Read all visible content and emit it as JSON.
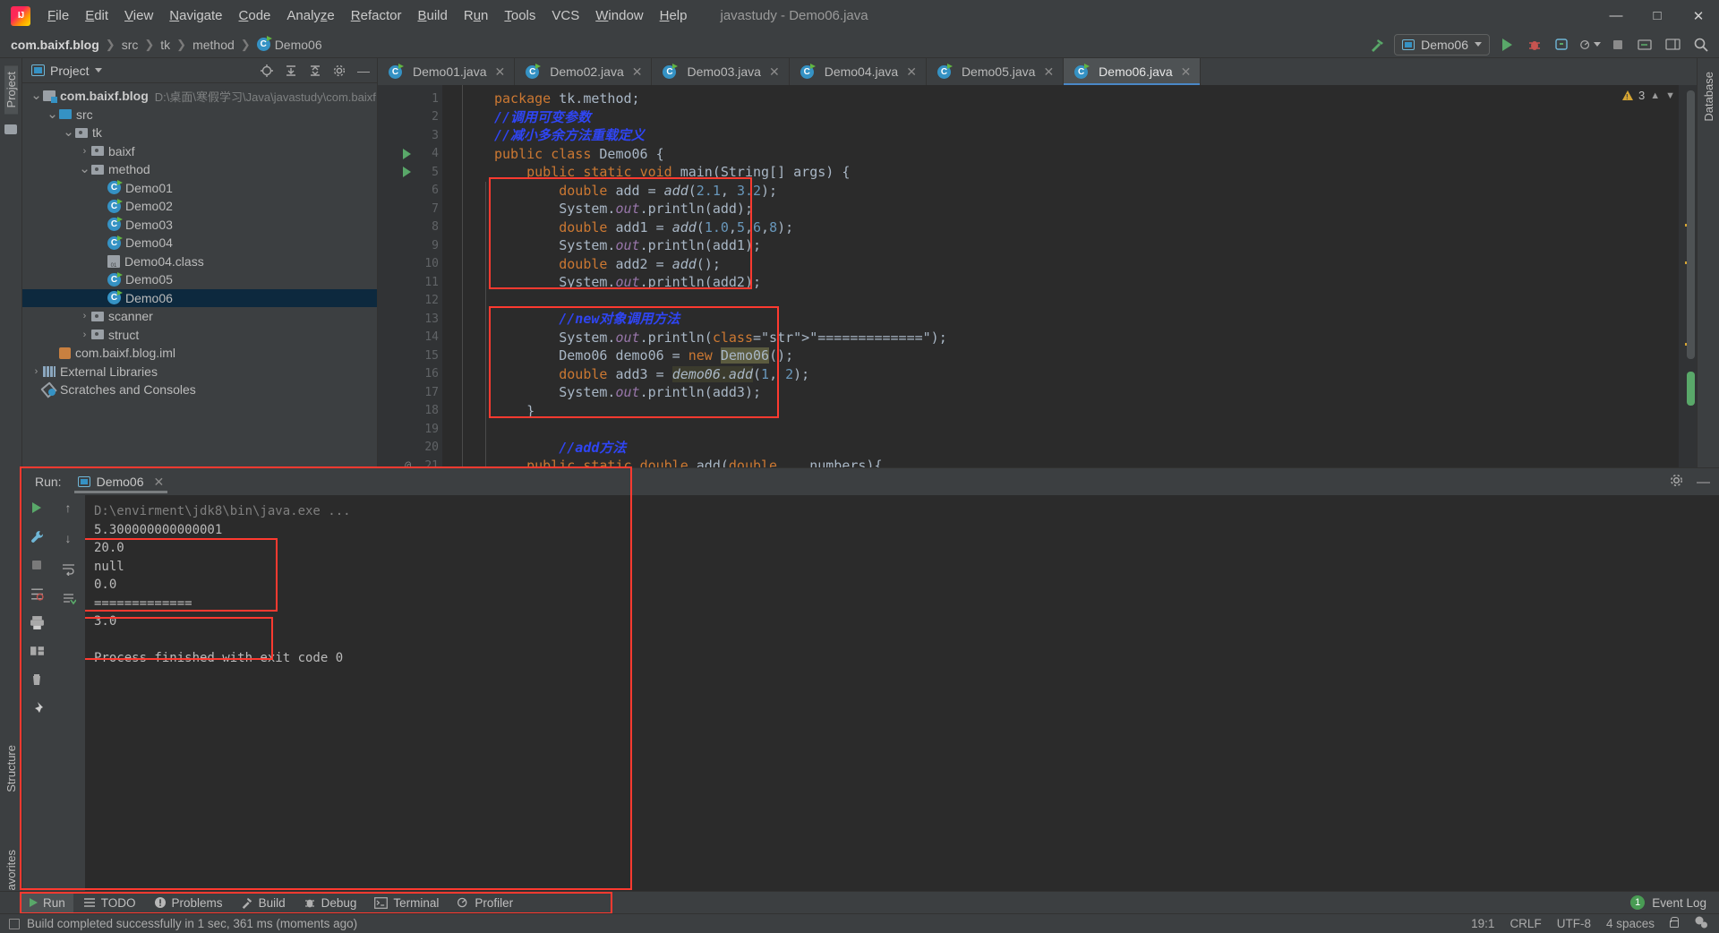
{
  "window": {
    "title": "javastudy - Demo06.java",
    "controls": [
      "minimize",
      "maximize",
      "close"
    ]
  },
  "menu": [
    {
      "label": "File"
    },
    {
      "label": "Edit"
    },
    {
      "label": "View"
    },
    {
      "label": "Navigate"
    },
    {
      "label": "Code"
    },
    {
      "label": "Analyze"
    },
    {
      "label": "Refactor"
    },
    {
      "label": "Build"
    },
    {
      "label": "Run"
    },
    {
      "label": "Tools"
    },
    {
      "label": "VCS"
    },
    {
      "label": "Window"
    },
    {
      "label": "Help"
    }
  ],
  "breadcrumb": {
    "items": [
      "com.baixf.blog",
      "src",
      "tk",
      "method",
      "Demo06"
    ]
  },
  "toolbar": {
    "run_config": "Demo06",
    "icons": [
      "hammer-icon",
      "run-icon",
      "debug-icon",
      "coverage-icon",
      "profile-icon",
      "stop-icon",
      "git-update-icon",
      "layout-icon",
      "search-icon"
    ]
  },
  "project_panel": {
    "title": "Project",
    "tools": [
      "locate-icon",
      "expand-all-icon",
      "collapse-all-icon",
      "settings-icon",
      "hide-icon"
    ],
    "tree": [
      {
        "label": "com.baixf.blog",
        "path": "D:\\桌面\\寒假学习\\Java\\javastudy\\com.baixf.b",
        "indent": 0,
        "arrow": "v",
        "icon": "module-icon",
        "bold": true,
        "selected": false
      },
      {
        "label": "src",
        "path": "",
        "indent": 1,
        "arrow": "v",
        "icon": "source-folder-icon",
        "bold": false,
        "selected": false
      },
      {
        "label": "tk",
        "path": "",
        "indent": 2,
        "arrow": "v",
        "icon": "package-icon",
        "bold": false,
        "selected": false
      },
      {
        "label": "baixf",
        "path": "",
        "indent": 3,
        "arrow": ">",
        "icon": "package-icon",
        "bold": false,
        "selected": false
      },
      {
        "label": "method",
        "path": "",
        "indent": 3,
        "arrow": "v",
        "icon": "package-icon",
        "bold": false,
        "selected": false
      },
      {
        "label": "Demo01",
        "path": "",
        "indent": 4,
        "arrow": "",
        "icon": "java-class-icon",
        "bold": false,
        "selected": false
      },
      {
        "label": "Demo02",
        "path": "",
        "indent": 4,
        "arrow": "",
        "icon": "java-class-icon",
        "bold": false,
        "selected": false
      },
      {
        "label": "Demo03",
        "path": "",
        "indent": 4,
        "arrow": "",
        "icon": "java-class-icon",
        "bold": false,
        "selected": false
      },
      {
        "label": "Demo04",
        "path": "",
        "indent": 4,
        "arrow": "",
        "icon": "java-class-icon",
        "bold": false,
        "selected": false
      },
      {
        "label": "Demo04.class",
        "path": "",
        "indent": 4,
        "arrow": "",
        "icon": "class-file-icon",
        "bold": false,
        "selected": false
      },
      {
        "label": "Demo05",
        "path": "",
        "indent": 4,
        "arrow": "",
        "icon": "java-class-icon",
        "bold": false,
        "selected": false
      },
      {
        "label": "Demo06",
        "path": "",
        "indent": 4,
        "arrow": "",
        "icon": "java-class-icon",
        "bold": false,
        "selected": true
      },
      {
        "label": "scanner",
        "path": "",
        "indent": 3,
        "arrow": ">",
        "icon": "package-icon",
        "bold": false,
        "selected": false
      },
      {
        "label": "struct",
        "path": "",
        "indent": 3,
        "arrow": ">",
        "icon": "package-icon",
        "bold": false,
        "selected": false
      },
      {
        "label": "com.baixf.blog.iml",
        "path": "",
        "indent": 1,
        "arrow": "",
        "icon": "iml-file-icon",
        "bold": false,
        "selected": false
      },
      {
        "label": "External Libraries",
        "path": "",
        "indent": 0,
        "arrow": ">",
        "icon": "library-icon",
        "bold": false,
        "selected": false
      },
      {
        "label": "Scratches and Consoles",
        "path": "",
        "indent": 0,
        "arrow": "",
        "icon": "scratches-icon",
        "bold": false,
        "selected": false
      }
    ]
  },
  "editor": {
    "tabs": [
      {
        "label": "Demo01.java",
        "active": false
      },
      {
        "label": "Demo02.java",
        "active": false
      },
      {
        "label": "Demo03.java",
        "active": false
      },
      {
        "label": "Demo04.java",
        "active": false
      },
      {
        "label": "Demo05.java",
        "active": false
      },
      {
        "label": "Demo06.java",
        "active": true
      }
    ],
    "warning_count": "3",
    "lines": [
      {
        "n": "1",
        "text": "package tk.method;"
      },
      {
        "n": "2",
        "text": "//调用可变参数"
      },
      {
        "n": "3",
        "text": "//减小多余方法重载定义"
      },
      {
        "n": "4",
        "text": "public class Demo06 {"
      },
      {
        "n": "5",
        "text": "    public static void main(String[] args) {"
      },
      {
        "n": "6",
        "text": "        double add = add(2.1, 3.2);"
      },
      {
        "n": "7",
        "text": "        System.out.println(add);"
      },
      {
        "n": "8",
        "text": "        double add1 = add(1.0,5,6,8);"
      },
      {
        "n": "9",
        "text": "        System.out.println(add1);"
      },
      {
        "n": "10",
        "text": "        double add2 = add();"
      },
      {
        "n": "11",
        "text": "        System.out.println(add2);"
      },
      {
        "n": "12",
        "text": ""
      },
      {
        "n": "13",
        "text": "        //new对象调用方法"
      },
      {
        "n": "14",
        "text": "        System.out.println(\"=============\");"
      },
      {
        "n": "15",
        "text": "        Demo06 demo06 = new Demo06();"
      },
      {
        "n": "16",
        "text": "        double add3 = demo06.add(1, 2);"
      },
      {
        "n": "17",
        "text": "        System.out.println(add3);"
      },
      {
        "n": "18",
        "text": "    }"
      },
      {
        "n": "19",
        "text": ""
      },
      {
        "n": "20",
        "text": "        //add方法"
      },
      {
        "n": "21",
        "text": "    public static double add(double... numbers){"
      }
    ]
  },
  "run_panel": {
    "label": "Run:",
    "tab": "Demo06",
    "toolbar_icons": [
      "rerun-icon",
      "up-arrow-icon",
      "down-arrow-icon",
      "stop-icon",
      "wrench-icon",
      "filter-icon",
      "soft-wrap-icon",
      "scroll-to-end-icon",
      "print-icon",
      "layout-icon",
      "trash-icon",
      "pin-icon"
    ],
    "header_icons": [
      "settings-gear-icon",
      "minimize-icon"
    ],
    "console": [
      {
        "text": "D:\\envirment\\jdk8\\bin\\java.exe ...",
        "muted": true
      },
      {
        "text": "5.300000000000001",
        "muted": false
      },
      {
        "text": "20.0",
        "muted": false
      },
      {
        "text": "null",
        "muted": false
      },
      {
        "text": "0.0",
        "muted": false
      },
      {
        "text": "=============",
        "muted": false
      },
      {
        "text": "3.0",
        "muted": false
      },
      {
        "text": "",
        "muted": false
      },
      {
        "text": "Process finished with exit code 0",
        "muted": false
      }
    ]
  },
  "bottom_toolbar": {
    "items": [
      {
        "label": "Run",
        "icon": "play-icon",
        "active": true
      },
      {
        "label": "TODO",
        "icon": "list-icon",
        "active": false
      },
      {
        "label": "Problems",
        "icon": "error-icon",
        "active": false
      },
      {
        "label": "Build",
        "icon": "hammer-icon",
        "active": false
      },
      {
        "label": "Debug",
        "icon": "bug-icon",
        "active": false
      },
      {
        "label": "Terminal",
        "icon": "terminal-icon",
        "active": false
      },
      {
        "label": "Profiler",
        "icon": "profiler-icon",
        "active": false
      }
    ],
    "event_log": {
      "label": "Event Log",
      "count": "1"
    }
  },
  "status_bar": {
    "message": "Build completed successfully in 1 sec, 361 ms (moments ago)",
    "caret": "19:1",
    "line_sep": "CRLF",
    "encoding": "UTF-8",
    "indent": "4 spaces",
    "icons": [
      "lock-icon",
      "inspections-icon"
    ]
  },
  "left_rail": {
    "items": [
      "Project",
      "Structure",
      "Favorites"
    ]
  },
  "right_rail": {
    "items": [
      "Database"
    ]
  },
  "colors": {
    "accent": "#3592c4",
    "annotation": "#ff3a30",
    "run_green": "#59a869",
    "keyword": "#cc7832",
    "string": "#6a8759",
    "number": "#6897bb",
    "comment_cn": "#2f45f3",
    "field": "#9876aa",
    "bg_editor": "#2b2b2b",
    "bg_ui": "#3c3f41"
  }
}
